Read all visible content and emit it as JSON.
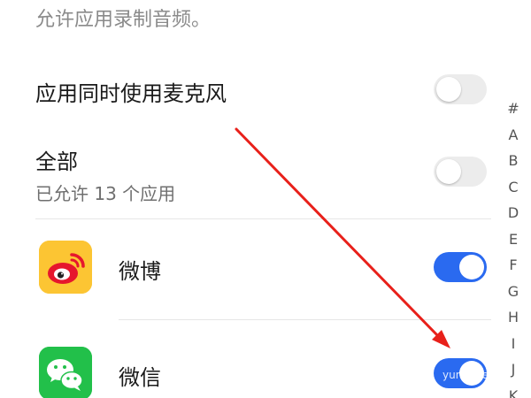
{
  "header": {
    "description": "允许应用录制音频。"
  },
  "settings": {
    "simultaneous_mic": {
      "label": "应用同时使用麦克风",
      "enabled": false
    },
    "all": {
      "label": "全部",
      "subtitle": "已允许 13 个应用",
      "enabled": false
    }
  },
  "apps": [
    {
      "name": "微博",
      "icon": "weibo-icon",
      "enabled": true
    },
    {
      "name": "微信",
      "icon": "wechat-icon",
      "enabled": true
    }
  ],
  "alpha_index": [
    "#",
    "A",
    "B",
    "C",
    "D",
    "E",
    "F",
    "G",
    "H",
    "I",
    "J",
    "K"
  ],
  "colors": {
    "toggle_on": "#2a6af0",
    "toggle_off": "#ececec",
    "arrow": "#e8201a",
    "weibo_bg": "#fbc02d",
    "wechat_bg": "#22c04a"
  },
  "watermark": "yunlu.net"
}
